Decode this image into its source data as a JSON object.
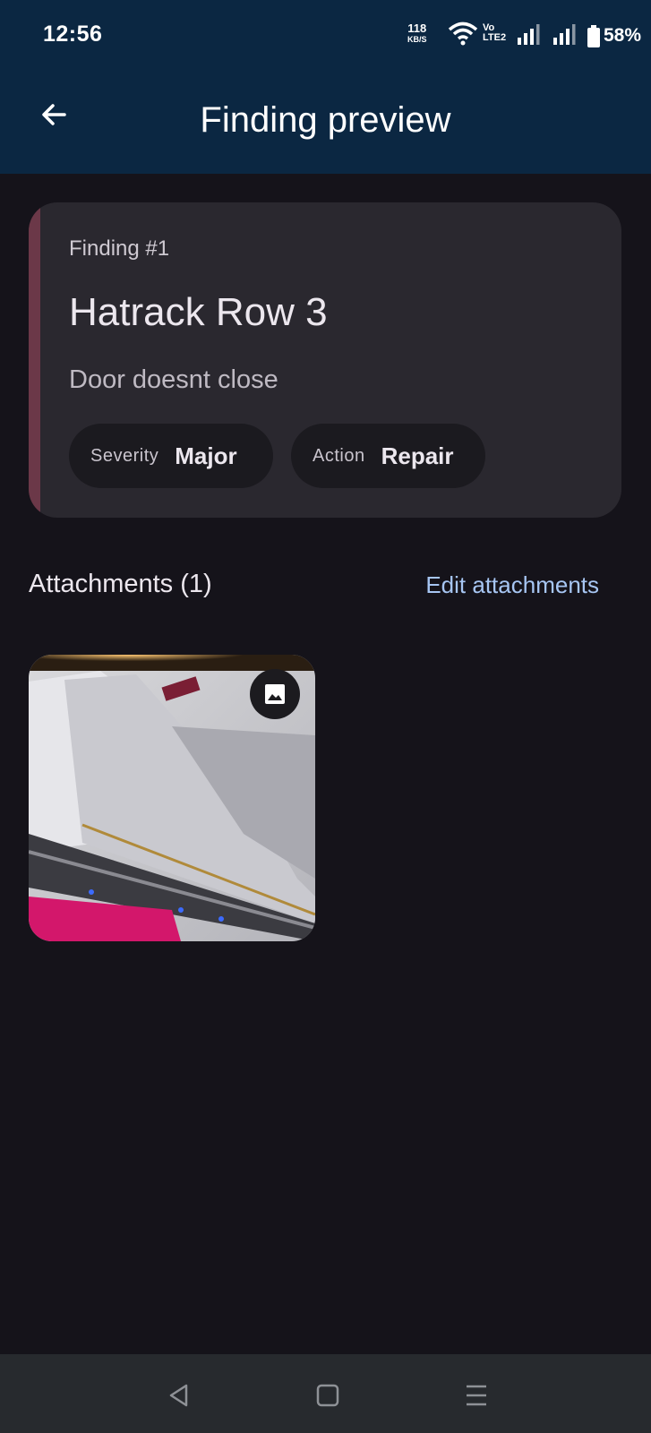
{
  "status_bar": {
    "time": "12:56",
    "net_speed_value": "118",
    "net_speed_unit": "KB/S",
    "volte_top": "Vo",
    "volte_bottom": "LTE2",
    "battery_percent": "58%"
  },
  "app_bar": {
    "title": "Finding preview",
    "back_icon": "arrow-back-icon"
  },
  "finding": {
    "label": "Finding #1",
    "location": "Hatrack Row 3",
    "description": "Door doesnt close",
    "severity_key": "Severity",
    "severity_value": "Major",
    "action_key": "Action",
    "action_value": "Repair",
    "accent_color": "#6b3848"
  },
  "attachments": {
    "title": "Attachments (1)",
    "edit_label": "Edit attachments",
    "items": [
      {
        "type": "image",
        "badge_icon": "image-icon"
      }
    ]
  },
  "nav_bar": {
    "back_icon": "triangle-back-icon",
    "home_icon": "square-home-icon",
    "menu_icon": "menu-lines-icon"
  },
  "colors": {
    "app_bar": "#0b2742",
    "background": "#15131a",
    "card": "#2a282f",
    "link": "#a7c6f3"
  }
}
